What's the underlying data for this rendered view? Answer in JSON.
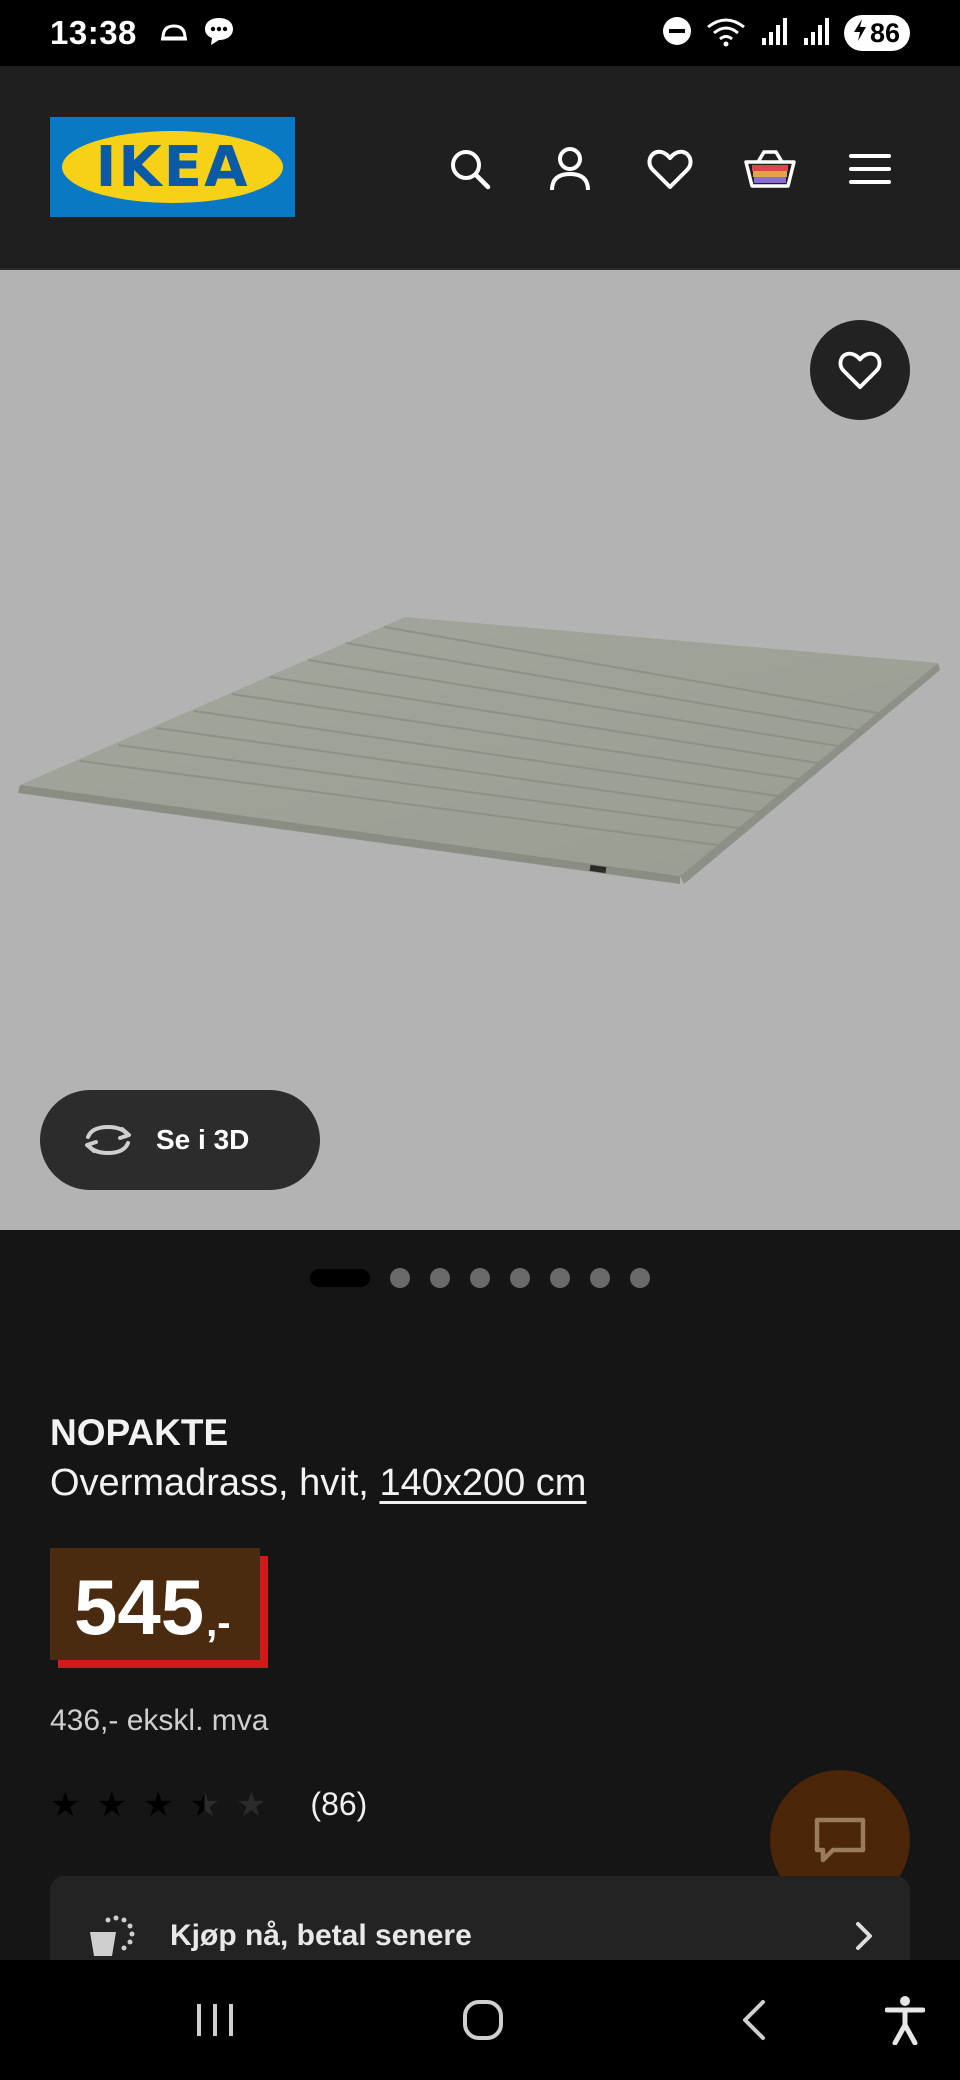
{
  "status_bar": {
    "time": "13:38",
    "battery": "86",
    "icons": [
      "cloud-icon",
      "chat-bubble-icon",
      "do-not-disturb-icon",
      "wifi-icon",
      "signal-icon",
      "signal-icon",
      "battery-charging-icon"
    ]
  },
  "header": {
    "logo_text": "IKEA",
    "icons": [
      "search-icon",
      "profile-icon",
      "heart-icon",
      "basket-icon",
      "menu-icon"
    ]
  },
  "hero": {
    "see_3d_label": "Se i 3D",
    "slide_count": 8,
    "active_slide": 1
  },
  "product": {
    "name": "NOPAKTE",
    "description": "Overmadrass, hvit,",
    "size": "140x200 cm",
    "price": "545",
    "price_suffix": ",-",
    "ex_vat": "436,- ekskl. mva",
    "rating_stars": 3.5,
    "review_count": "(86)"
  },
  "bnpl": {
    "label": "Kjøp nå, betal senere"
  },
  "colors": {
    "price_bg": "#4b2b10",
    "price_accent": "#d21a1a",
    "hero_bg": "#b3b3b3",
    "ikea_blue": "#0a79c5",
    "ikea_yellow": "#f7d117"
  }
}
